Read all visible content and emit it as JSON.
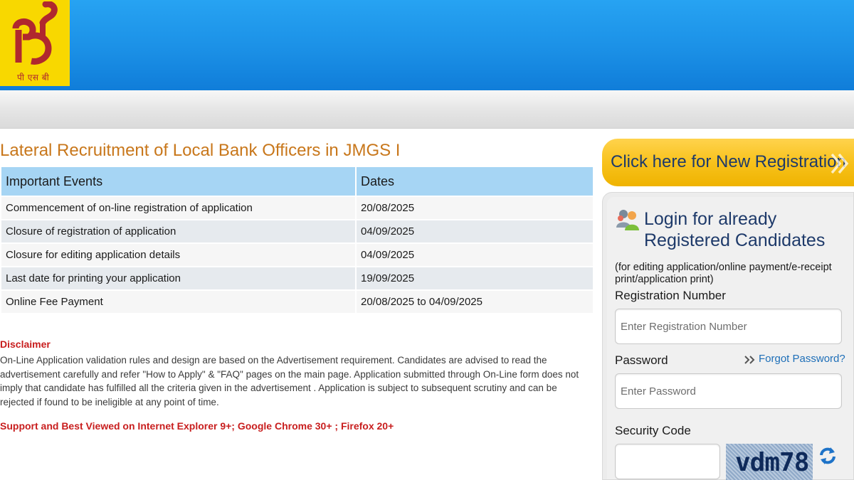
{
  "header": {
    "logo_text": "पी एस बी",
    "colors": {
      "header_blue": "#1b90e6",
      "logo_yellow": "#f8d800",
      "logo_red": "#b0282e"
    }
  },
  "main": {
    "title": "Lateral Recruitment of Local Bank Officers in JMGS I",
    "table": {
      "headers": [
        "Important Events",
        "Dates"
      ],
      "rows": [
        {
          "event": "Commencement of on-line registration of application",
          "date": "20/08/2025"
        },
        {
          "event": "Closure of registration of application",
          "date": "04/09/2025"
        },
        {
          "event": "Closure for editing application details",
          "date": "04/09/2025"
        },
        {
          "event": "Last date for printing your application",
          "date": "19/09/2025"
        },
        {
          "event": "Online Fee Payment",
          "date": "20/08/2025 to 04/09/2025"
        }
      ]
    },
    "disclaimer_title": "Disclaimer",
    "disclaimer_text": "On-Line Application validation rules and design are based on the Advertisement requirement. Candidates are advised to read the advertisement carefully and refer \"How to Apply\" & \"FAQ\" pages on the main page. Application submitted through On-Line form does not imply that candidate has fulfilled all the criteria given in the advertisement . Application is subject to subsequent scrutiny and can be rejected if found to be ineligible at any point of time.",
    "support_text": "Support and Best Viewed on Internet Explorer 9+; Google Chrome 30+ ; Firefox 20+"
  },
  "sidebar": {
    "new_registration_label": "Click here for New Registration",
    "login_title_line1": "Login for already",
    "login_title_line2": "Registered Candidates",
    "login_note": "(for editing application/online payment/e-receipt print/application print)",
    "registration_label": "Registration Number",
    "registration_placeholder": "Enter Registration Number",
    "password_label": "Password",
    "password_placeholder": "Enter Password",
    "forgot_password": "Forgot Password?",
    "security_code_label": "Security Code",
    "captcha_text": "vdm78",
    "icons": [
      "users-icon",
      "double-chevron-icon",
      "refresh-icon"
    ]
  }
}
